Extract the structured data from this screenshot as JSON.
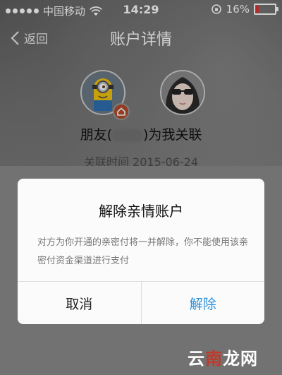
{
  "status_bar": {
    "carrier": "中国移动",
    "time": "14:29",
    "battery": "16%",
    "battery_level": 0.16
  },
  "nav": {
    "back_label": "返回",
    "title": "账户详情"
  },
  "profile": {
    "relation_prefix": "朋友(",
    "relation_suffix": ")为我关联",
    "assoc_time": "关联时间 2015-06-24"
  },
  "modal": {
    "title": "解除亲情账户",
    "message": "对方为你开通的亲密付将一并解除，你不能使用该亲密付资金渠道进行支付",
    "cancel_label": "取消",
    "confirm_label": "解除"
  },
  "watermark": {
    "part1": "云",
    "part2": "南",
    "part3": "龙网"
  },
  "colors": {
    "accent": "#2a8fdc",
    "battery_low": "#e03131"
  }
}
